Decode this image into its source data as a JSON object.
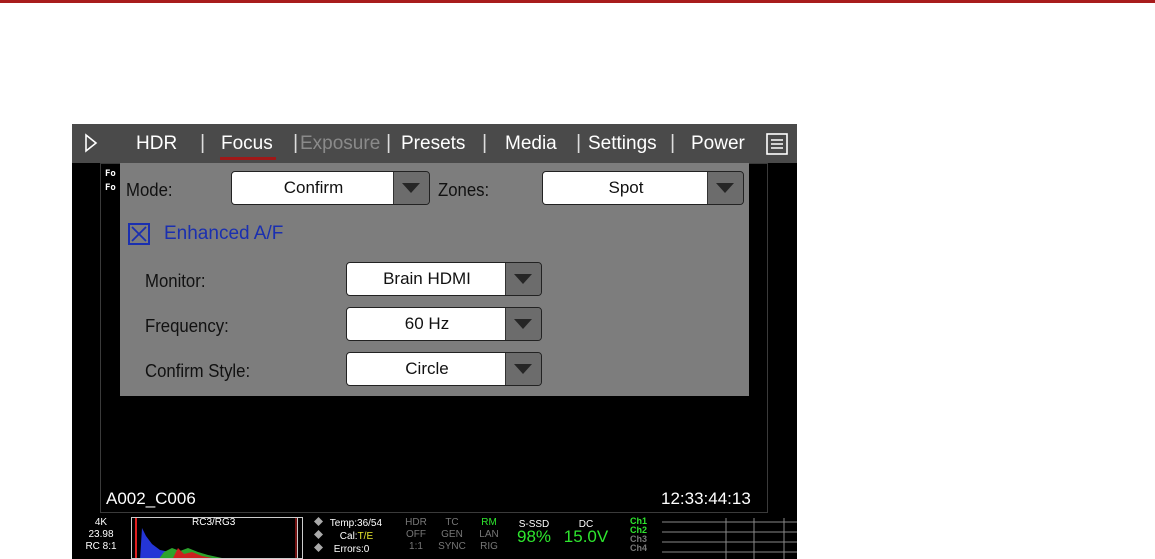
{
  "menu": {
    "items": [
      {
        "label": "HDR",
        "state": "normal"
      },
      {
        "label": "Focus",
        "state": "active"
      },
      {
        "label": "Exposure",
        "state": "disabled"
      },
      {
        "label": "Presets",
        "state": "normal"
      },
      {
        "label": "Media",
        "state": "normal"
      },
      {
        "label": "Settings",
        "state": "normal"
      },
      {
        "label": "Power",
        "state": "normal"
      }
    ],
    "separator": "|"
  },
  "overlay_fragments": [
    "Fo",
    "Fo"
  ],
  "focus_panel": {
    "mode_label": "Mode:",
    "mode_value": "Confirm",
    "zones_label": "Zones:",
    "zones_value": "Spot",
    "enhanced_af_label": "Enhanced A/F",
    "enhanced_af_checked": true,
    "monitor_label": "Monitor:",
    "monitor_value": "Brain HDMI",
    "frequency_label": "Frequency:",
    "frequency_value": "60 Hz",
    "confirm_style_label": "Confirm Style:",
    "confirm_style_value": "Circle"
  },
  "viewport": {
    "clip_name": "A002_C006",
    "timecode": "12:33:44:13"
  },
  "status_bar": {
    "resolution": "4K",
    "fps": "23.98",
    "compression": "RC 8:1",
    "color_profile": "RC3/RG3",
    "temp": "Temp:36/54",
    "cal_prefix": "Cal:",
    "cal_value": "T/E",
    "errors": "Errors:0",
    "hdr_label": "HDR",
    "hdr_value": "OFF",
    "hdr_ratio": "1:1",
    "tc_label": "TC",
    "tc_gen": "GEN",
    "tc_sync": "SYNC",
    "rm_label": "RM",
    "lan_label": "LAN",
    "rig_label": "RIG",
    "media_label": "S-SSD",
    "media_value": "98%",
    "power_label": "DC",
    "power_value": "15.0V",
    "channels": [
      "Ch1",
      "Ch2",
      "Ch3",
      "Ch4"
    ]
  },
  "colors": {
    "accent_red": "#a81c1c",
    "active_underline": "#a01818",
    "panel_gray": "#7d7d7d",
    "checkbox_blue": "#1a2fb0",
    "status_green": "#2ee62e"
  }
}
